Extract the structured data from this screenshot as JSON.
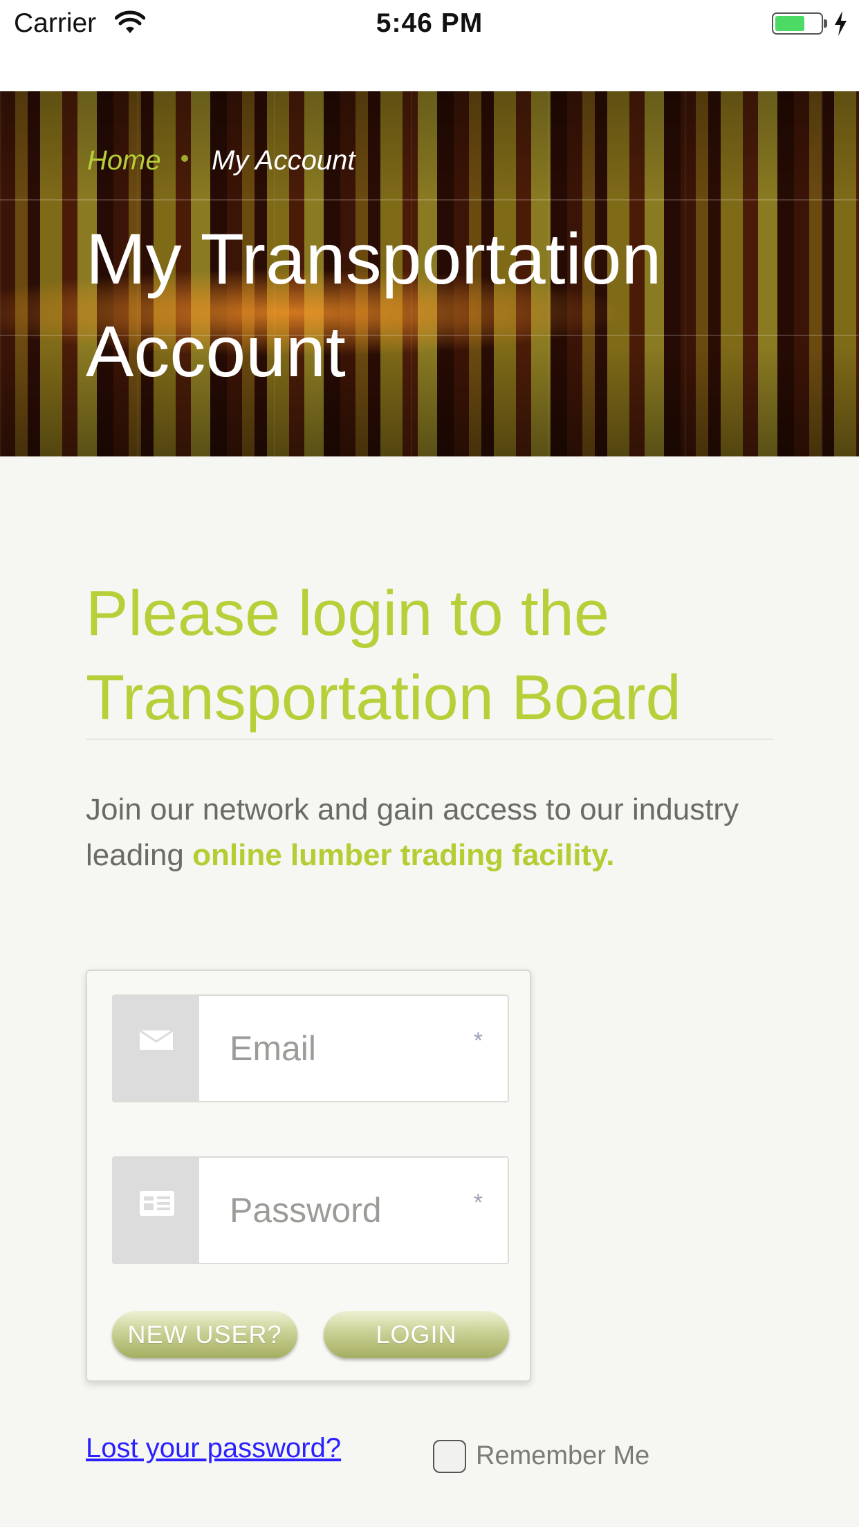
{
  "status_bar": {
    "carrier": "Carrier",
    "time": "5:46 PM"
  },
  "breadcrumb": {
    "home": "Home",
    "current": "My Account"
  },
  "hero": {
    "title": "My Transportation Account"
  },
  "main": {
    "heading": "Please login to the Transportation Board",
    "intro_text": "Join our network and gain access to our industry leading ",
    "intro_highlight": "online lumber trading facility."
  },
  "form": {
    "email": {
      "placeholder": "Email",
      "value": "",
      "required_mark": "*",
      "icon": "envelope-icon"
    },
    "password": {
      "placeholder": "Password",
      "value": "",
      "required_mark": "*",
      "icon": "id-card-icon"
    },
    "new_user_label": "NEW USER?",
    "login_label": "LOGIN"
  },
  "footer": {
    "lost_password": "Lost your password?",
    "remember_me": "Remember Me",
    "remember_checked": false
  },
  "colors": {
    "accent": "#b8cf3a",
    "link": "#2b20ff",
    "body_text": "#6a6a66"
  }
}
